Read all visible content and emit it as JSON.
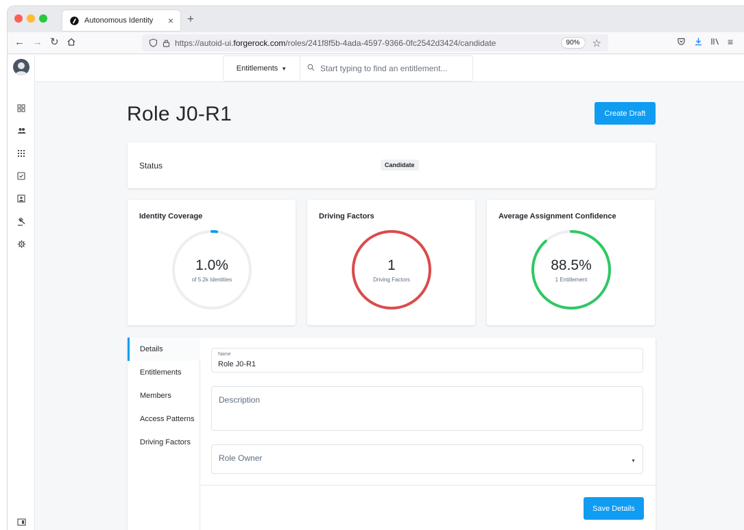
{
  "browser": {
    "tab_title": "Autonomous Identity",
    "tab_close": "×",
    "new_tab": "+",
    "url_prefix": "https://autoid-ui.",
    "url_host": "forgerock.com",
    "url_path": "/roles/241f8f5b-4ada-4597-9366-0fc2542d3424/candidate",
    "zoom": "90%"
  },
  "topbar": {
    "search_select": "Entitlements",
    "search_placeholder": "Start typing to find an entitlement..."
  },
  "page": {
    "title": "Role J0-R1",
    "create_draft": "Create Draft"
  },
  "status": {
    "label": "Status",
    "badge": "Candidate"
  },
  "metrics": [
    {
      "title": "Identity Coverage",
      "value": "1.0%",
      "sub": "of 5.2k Identities",
      "fraction": 0.01,
      "color": "#109cf1"
    },
    {
      "title": "Driving Factors",
      "value": "1",
      "sub": "Driving Factors",
      "fraction": 1.0,
      "color": "#dc4b4b"
    },
    {
      "title": "Average Assignment Confidence",
      "value": "88.5%",
      "sub": "1 Entitlement",
      "fraction": 0.885,
      "color": "#2ec866"
    }
  ],
  "details": {
    "nav": [
      "Details",
      "Entitlements",
      "Members",
      "Access Patterns",
      "Driving Factors"
    ],
    "name_label": "Name",
    "name_value": "Role J0-R1",
    "description_placeholder": "Description",
    "owner_placeholder": "Role Owner",
    "save_label": "Save Details"
  },
  "colors": {
    "primary": "#109cf1",
    "ring_track": "#eeeeee"
  }
}
